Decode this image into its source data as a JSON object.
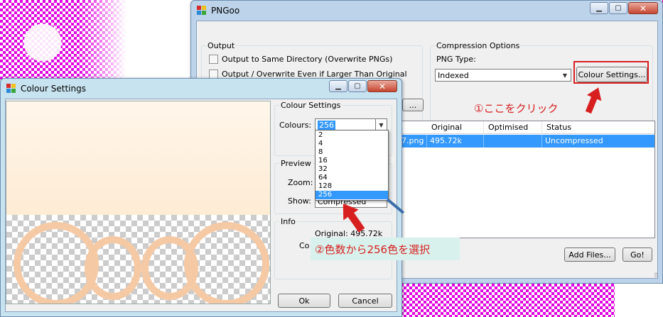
{
  "main_window": {
    "title": "PNGoo",
    "output_group": {
      "title": "Output",
      "opt_same_dir": "Output to Same Directory (Overwrite PNGs)",
      "opt_overwrite": "Output / Overwrite Even if Larger Than Original",
      "browse_label": "..."
    },
    "compression_group": {
      "title": "Compression Options",
      "png_type_label": "PNG Type:",
      "png_type_value": "Indexed",
      "colour_settings_button": "Colour Settings..."
    },
    "table": {
      "columns": [
        "Original",
        "Optimised",
        "Status"
      ],
      "rows": [
        {
          "file": "7.png",
          "original": "495.72k",
          "optimised": "",
          "status": "Uncompressed"
        }
      ]
    },
    "add_files_button": "Add Files...",
    "go_button": "Go!"
  },
  "colour_window": {
    "title": "Colour Settings",
    "colour_group": {
      "title": "Colour Settings",
      "colours_label": "Colours:",
      "colours_value": "256",
      "options": [
        "2",
        "4",
        "8",
        "16",
        "32",
        "64",
        "128",
        "256"
      ],
      "selected": "256"
    },
    "preview_group": {
      "title": "Preview",
      "zoom_label": "Zoom:",
      "show_label": "Show:",
      "show_value": "Compressed"
    },
    "info_group": {
      "title": "Info",
      "original_text": "Original: 495.72k",
      "compressed_label": "Co"
    },
    "ok_button": "Ok",
    "cancel_button": "Cancel"
  },
  "annotations": {
    "step1": "①ここをクリック",
    "step2": "②色数から256色を選択"
  },
  "colors": {
    "annotation_red": "#d81f1f",
    "selection_blue": "#3399ff",
    "desktop_magenta": "#e000e0"
  }
}
